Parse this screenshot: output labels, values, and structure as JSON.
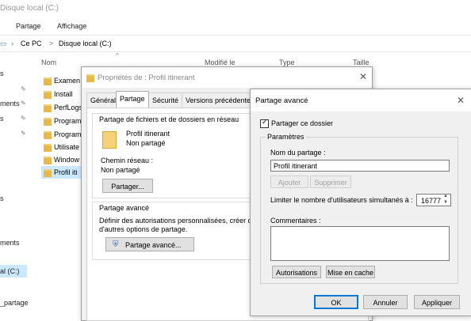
{
  "explorer": {
    "title": "Disque local (C:)",
    "ribbon_tabs": [
      "Partage",
      "Affichage"
    ],
    "breadcrumb": {
      "part1": "Ce PC",
      "sep": ">",
      "part2": "Disque local (C:)"
    },
    "columns": {
      "name": "Nom",
      "modified": "Modifié le",
      "type": "Type",
      "size": "Taille"
    },
    "nav_items": [
      "s",
      "ments",
      "s",
      "s",
      "ments",
      "al (C:)",
      "_partage"
    ],
    "files": [
      "Examen",
      "Install",
      "PerfLogs",
      "Program",
      "Program",
      "Utilisate",
      "Window",
      "Profil iti"
    ]
  },
  "properties": {
    "title": "Propriétés de : Profil itinerant",
    "tabs": [
      "Général",
      "Partage",
      "Sécurité",
      "Versions précédentes"
    ],
    "group1_title": "Partage de fichiers et de dossiers en réseau",
    "folder_name": "Profil itinerant",
    "folder_status": "Non partagé",
    "network_path_label": "Chemin réseau :",
    "network_path_value": "Non partagé",
    "share_button": "Partager...",
    "group2_title": "Partage avancé",
    "group2_desc_line1": "Définir des autorisations personnalisées, créer des r",
    "group2_desc_line2": "d'autres options de partage.",
    "advanced_button": "Partage avancé..."
  },
  "advanced": {
    "title": "Partage avancé",
    "share_checkbox_label": "Partager ce dossier",
    "share_checked": true,
    "params_title": "Paramètres",
    "share_name_label": "Nom du partage :",
    "share_name_value": "Profil itinerant",
    "add_button": "Ajouter",
    "remove_button": "Supprimer",
    "limit_label": "Limiter le nombre d'utilisateurs simultanés à :",
    "limit_value": "16777",
    "comments_label": "Commentaires :",
    "comments_value": "",
    "permissions_button": "Autorisations",
    "cache_button": "Mise en cache",
    "ok_button": "OK",
    "cancel_button": "Annuler",
    "apply_button": "Appliquer"
  }
}
